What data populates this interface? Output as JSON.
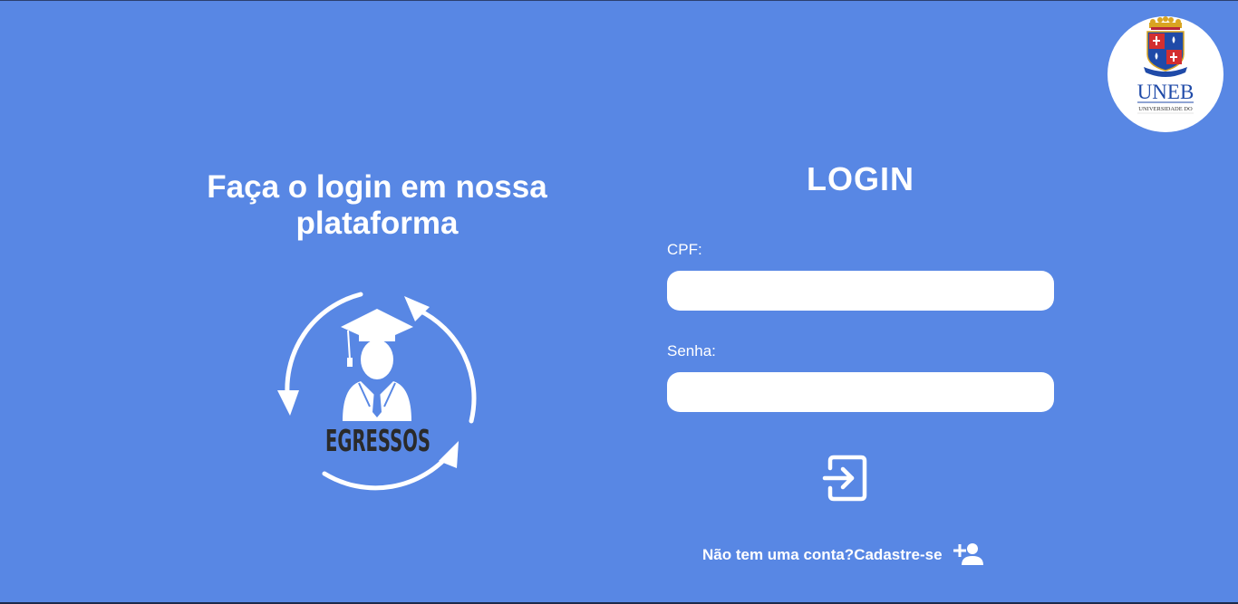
{
  "university_logo": {
    "acronym": "UNEB",
    "subtitle": "UNIVERSIDADE DO",
    "colors": {
      "red": "#d32f2f",
      "blue": "#1f4aa8",
      "gold": "#d9a521"
    }
  },
  "left": {
    "title": "Faça o login em nossa plataforma",
    "emblem_text": "EGRESSOS"
  },
  "login": {
    "title": "LOGIN",
    "cpf_label": "CPF:",
    "cpf_value": "",
    "password_label": "Senha:",
    "password_value": "",
    "submit_icon": "login-icon"
  },
  "signup": {
    "prompt": "Não tem uma conta?",
    "link_label": "Cadastre-se",
    "icon": "person-add-icon"
  },
  "colors": {
    "background": "#5887e4",
    "foreground": "#ffffff",
    "emblem_text": "#2a2a2a"
  }
}
